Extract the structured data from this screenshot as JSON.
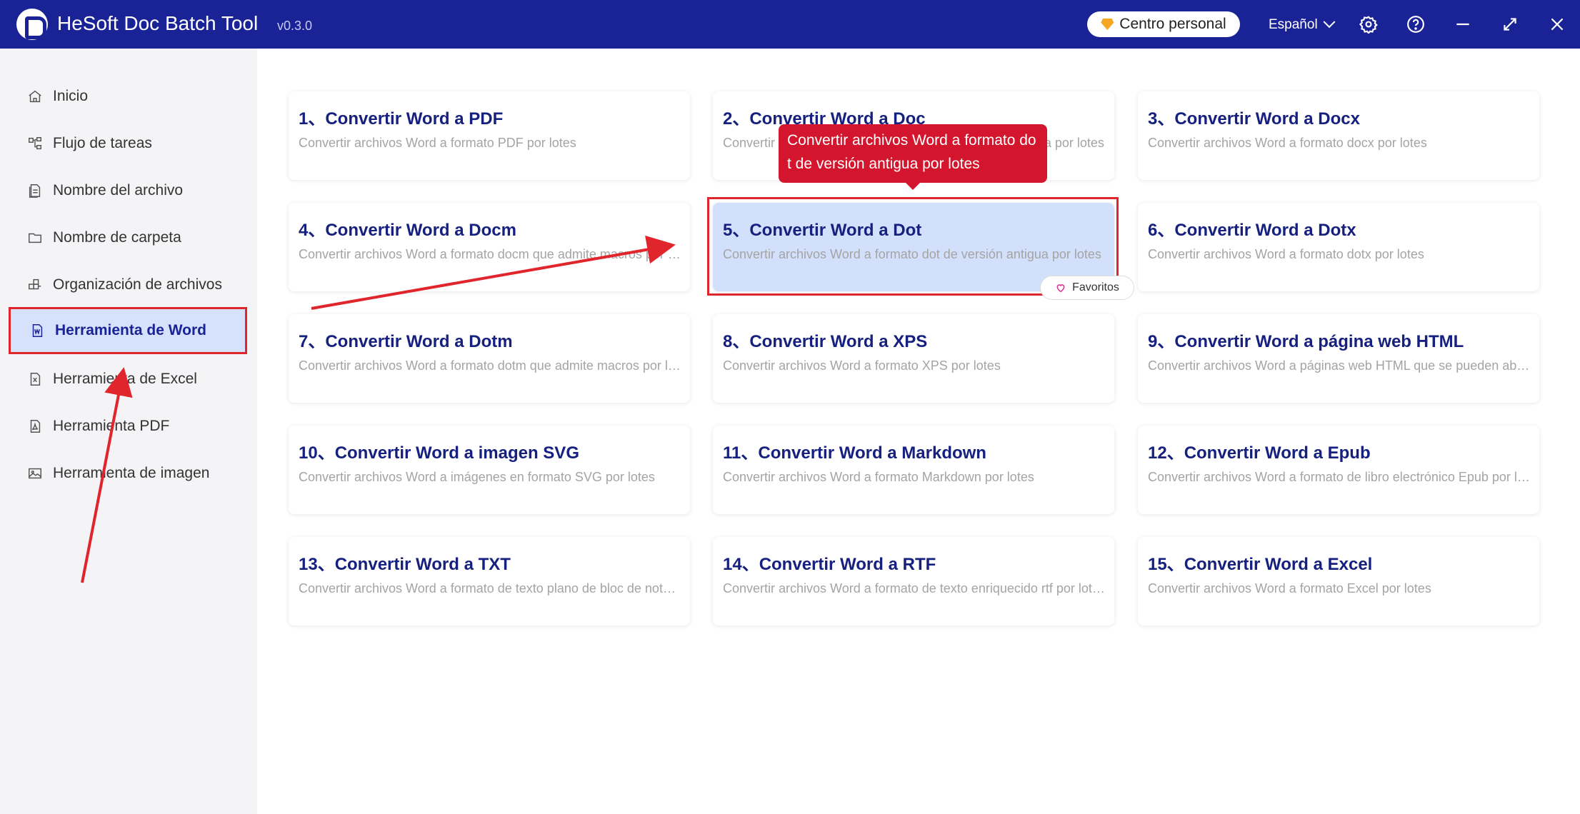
{
  "app": {
    "title": "HeSoft Doc Batch Tool",
    "version": "v0.3.0"
  },
  "header": {
    "personal_center": "Centro personal",
    "language": "Español",
    "icons": [
      "gear-icon",
      "help-icon",
      "minimize-icon",
      "maximize-icon",
      "close-icon"
    ]
  },
  "sidebar": {
    "items": [
      {
        "label": "Inicio",
        "icon": "home-icon"
      },
      {
        "label": "Flujo de tareas",
        "icon": "workflow-icon"
      },
      {
        "label": "Nombre del archivo",
        "icon": "file-name-icon"
      },
      {
        "label": "Nombre de carpeta",
        "icon": "folder-icon"
      },
      {
        "label": "Organización de archivos",
        "icon": "organize-icon"
      },
      {
        "label": "Herramienta de Word",
        "icon": "word-icon",
        "active": true
      },
      {
        "label": "Herramienta de Excel",
        "icon": "excel-icon"
      },
      {
        "label": "Herramienta PDF",
        "icon": "pdf-icon"
      },
      {
        "label": "Herramienta de imagen",
        "icon": "image-icon"
      }
    ]
  },
  "tools": [
    {
      "title": "1、Convertir Word a PDF",
      "desc": "Convertir archivos Word a formato PDF por lotes"
    },
    {
      "title": "2、Convertir Word a Doc",
      "desc": "Convertir archivos Word a formato doc de versión antigua por lotes"
    },
    {
      "title": "3、Convertir Word a Docx",
      "desc": "Convertir archivos Word a formato docx por lotes"
    },
    {
      "title": "4、Convertir Word a Docm",
      "desc": "Convertir archivos Word a formato docm que admite macros por lotes"
    },
    {
      "title": "5、Convertir Word a Dot",
      "desc": "Convertir archivos Word a formato dot de versión antigua por lotes"
    },
    {
      "title": "6、Convertir Word a Dotx",
      "desc": "Convertir archivos Word a formato dotx por lotes"
    },
    {
      "title": "7、Convertir Word a Dotm",
      "desc": "Convertir archivos Word a formato dotm que admite macros por lotes"
    },
    {
      "title": "8、Convertir Word a XPS",
      "desc": "Convertir archivos Word a formato XPS por lotes"
    },
    {
      "title": "9、Convertir Word a página web HTML",
      "desc": "Convertir archivos Word a páginas web HTML que se pueden abrir en el navegador"
    },
    {
      "title": "10、Convertir Word a imagen SVG",
      "desc": "Convertir archivos Word a imágenes en formato SVG por lotes"
    },
    {
      "title": "11、Convertir Word a Markdown",
      "desc": "Convertir archivos Word a formato Markdown por lotes"
    },
    {
      "title": "12、Convertir Word a Epub",
      "desc": "Convertir archivos Word a formato de libro electrónico Epub por lotes"
    },
    {
      "title": "13、Convertir Word a TXT",
      "desc": "Convertir archivos Word a formato de texto plano de bloc de notas por lotes"
    },
    {
      "title": "14、Convertir Word a RTF",
      "desc": "Convertir archivos Word a formato de texto enriquecido rtf por lotes"
    },
    {
      "title": "15、Convertir Word a Excel",
      "desc": "Convertir archivos Word a formato Excel por lotes"
    }
  ],
  "hovered_tool": {
    "tooltip_line1": "Convertir archivos Word a formato do",
    "tooltip_line2": "t de versión antigua por lotes",
    "favorite_label": "Favoritos"
  },
  "colors": {
    "titlebar": "#1a2396",
    "accent_red": "#e0252d",
    "card_title": "#16207e",
    "active_nav_bg": "#d6e1fb"
  }
}
